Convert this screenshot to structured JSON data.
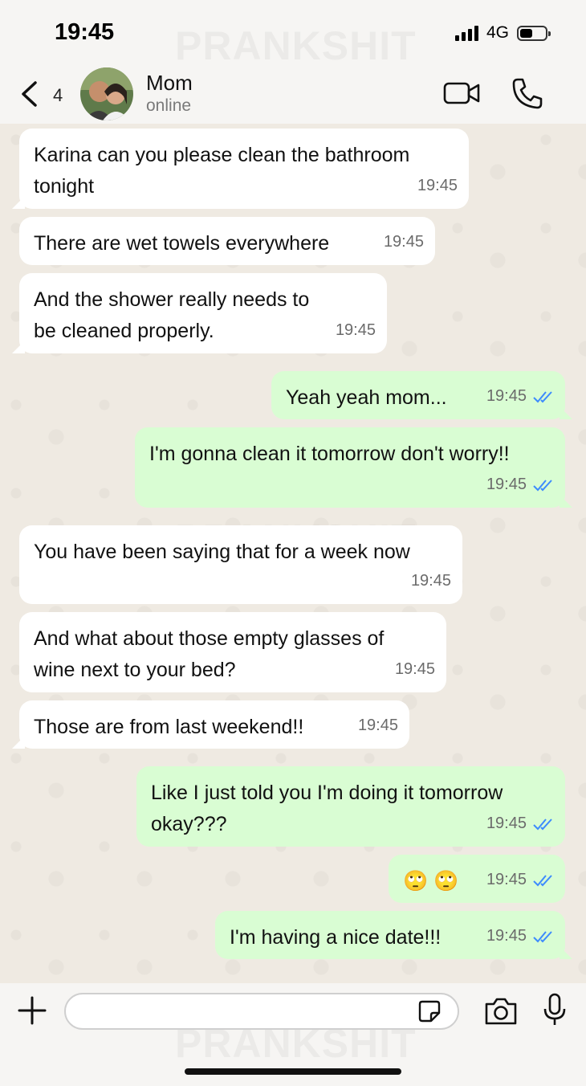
{
  "status_bar": {
    "time": "19:45",
    "network": "4G",
    "watermark": "PRANKSHIT"
  },
  "header": {
    "back_count": "4",
    "contact_name": "Mom",
    "contact_status": "online",
    "icons": [
      "chevron-left-icon",
      "video-camera-icon",
      "phone-icon"
    ]
  },
  "messages": [
    {
      "dir": "in",
      "text": "Karina can you please clean the bathroom tonight",
      "time": "19:45"
    },
    {
      "dir": "in",
      "text": "There are wet towels everywhere",
      "time": "19:45"
    },
    {
      "dir": "in",
      "text": "And the shower really needs to be cleaned properly.",
      "time": "19:45"
    },
    {
      "dir": "out",
      "text": "Yeah yeah mom...",
      "time": "19:45",
      "read": true
    },
    {
      "dir": "out",
      "text": "I'm gonna clean it tomorrow don't worry!!",
      "time": "19:45",
      "read": true
    },
    {
      "dir": "in",
      "text": "You have been saying that for a week now",
      "time": "19:45"
    },
    {
      "dir": "in",
      "text": "And what about those empty glasses of wine next to your bed?",
      "time": "19:45"
    },
    {
      "dir": "in",
      "text": "Those are from last weekend!!",
      "time": "19:45"
    },
    {
      "dir": "out",
      "text": "Like I just told you I'm doing it tomorrow okay???",
      "time": "19:45",
      "read": true
    },
    {
      "dir": "out",
      "text": "🙄 🙄",
      "time": "19:45",
      "read": true
    },
    {
      "dir": "out",
      "text": "I'm having a nice date!!!",
      "time": "19:45",
      "read": true
    }
  ],
  "composer": {
    "input_value": "",
    "icons": [
      "plus-icon",
      "sticker-icon",
      "camera-icon",
      "microphone-icon"
    ]
  },
  "colors": {
    "incoming_bubble": "#ffffff",
    "outgoing_bubble": "#d9fdd3",
    "read_ticks": "#3d8bfd"
  }
}
